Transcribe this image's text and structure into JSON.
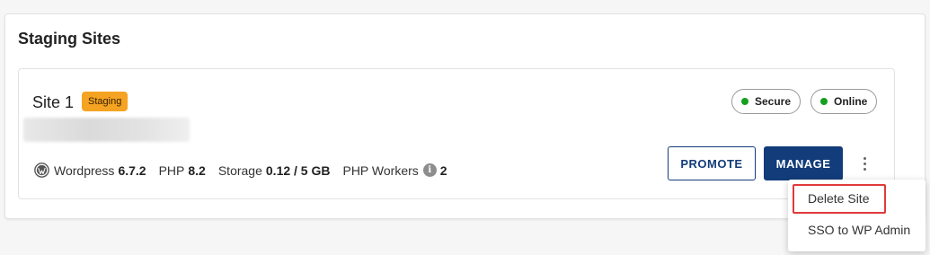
{
  "panel": {
    "title": "Staging Sites"
  },
  "site": {
    "name": "Site 1",
    "badge": "Staging",
    "status": [
      {
        "label": "Secure",
        "color": "#14a01e"
      },
      {
        "label": "Online",
        "color": "#14a01e"
      }
    ],
    "meta": {
      "wordpress_label": "Wordpress",
      "wordpress_version": "6.7.2",
      "php_label": "PHP",
      "php_version": "8.2",
      "storage_label": "Storage",
      "storage_value": "0.12 / 5 GB",
      "workers_label": "PHP Workers",
      "workers_value": "2"
    },
    "actions": {
      "promote": "PROMOTE",
      "manage": "MANAGE"
    }
  },
  "menu": {
    "items": [
      {
        "label": "Delete Site",
        "highlighted": true
      },
      {
        "label": "SSO to WP Admin",
        "highlighted": false
      }
    ]
  },
  "colors": {
    "primary": "#123c7a",
    "badge": "#f5a322",
    "status_ok": "#14a01e",
    "highlight": "#e03a3a"
  },
  "icons": {
    "wordpress": "wordpress-icon",
    "info": "info-icon",
    "more": "more-vertical-icon",
    "status": "status-dot-icon"
  }
}
